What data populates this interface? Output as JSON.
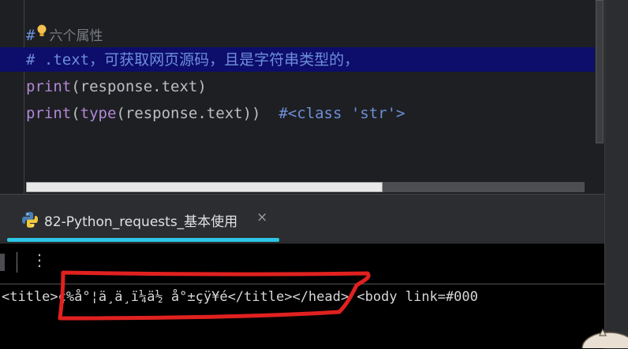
{
  "editor": {
    "lines": {
      "l1_hash": "#",
      "l1_text": "六个属性",
      "l2": "# .text，可获取网页源码，且是字符串类型的，",
      "l3_fn": "print",
      "l3_rest": "(response.text)",
      "l4_fn": "print",
      "l4_open": "(",
      "l4_fn2": "type",
      "l4_rest": "(response.text))  ",
      "l4_comment": "#<class 'str'>"
    }
  },
  "run_tab": {
    "label": "82-Python_requests_基本使用",
    "close": "×",
    "icon": "python-icon"
  },
  "toolbar": {
    "menu": "⋮"
  },
  "console": {
    "output": "<title>ç%å°¦ä¸ä¸ï¼ä½ å°±çÿ¥é</title></head> <body link=#000"
  },
  "colors": {
    "accent": "#2fc4e3",
    "annotation": "#e0211f",
    "highlight_row": "#0d0d6b"
  }
}
